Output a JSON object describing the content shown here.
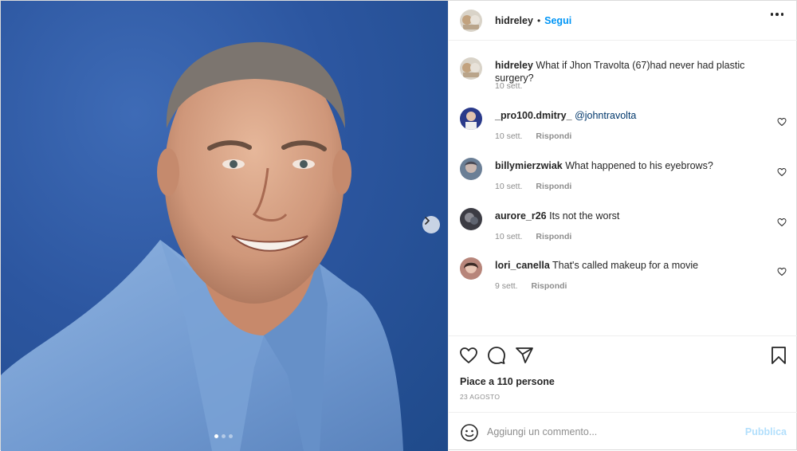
{
  "post": {
    "author": "hidreley",
    "separator": "•",
    "follow_label": "Segui",
    "more_icon": "more-horizontal-icon",
    "caption": {
      "username": "hidreley",
      "text": "What if Jhon Travolta (67)had never had plastic surgery?",
      "time": "10 sett."
    }
  },
  "carousel": {
    "next_icon": "chevron-right-icon",
    "slide_count": 3,
    "active_slide": 1
  },
  "comments": [
    {
      "username": "_pro100.dmitry_",
      "mention": "@johntravolta",
      "text": "",
      "time": "10 sett.",
      "reply": "Rispondi",
      "avatar_color": "#2a3a8a"
    },
    {
      "username": "billymierzwiak",
      "mention": "",
      "text": "What happened to his eyebrows?",
      "time": "10 sett.",
      "reply": "Rispondi",
      "avatar_color": "#6b7f96"
    },
    {
      "username": "aurore_r26",
      "mention": "",
      "text": "Its not the worst",
      "time": "10 sett.",
      "reply": "Rispondi",
      "avatar_color": "#3c3c44"
    },
    {
      "username": "lori_canella",
      "mention": "",
      "text": "That's called makeup for a movie",
      "time": "9 sett.",
      "reply": "Rispondi",
      "avatar_color": "#b7857a"
    }
  ],
  "actions": {
    "like_icon": "heart-icon",
    "comment_icon": "comment-icon",
    "share_icon": "send-icon",
    "save_icon": "bookmark-icon",
    "likes_text": "Piace a 110 persone",
    "date": "23 AGOSTO"
  },
  "add_comment": {
    "emoji_icon": "smiley-icon",
    "placeholder": "Aggiungi un commento...",
    "publish_label": "Pubblica"
  },
  "colors": {
    "accent": "#0095f6",
    "publish_disabled": "#b2dffc",
    "muted": "#8e8e8e",
    "text": "#262626"
  }
}
